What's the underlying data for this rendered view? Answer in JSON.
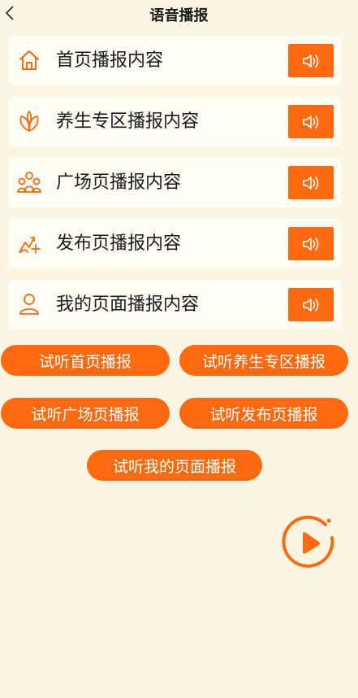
{
  "header": {
    "title": "语音播报",
    "back_icon": "chevron-left-icon"
  },
  "items": [
    {
      "label": "首页播报内容",
      "icon": "home-icon"
    },
    {
      "label": "养生专区播报内容",
      "icon": "leaf-icon"
    },
    {
      "label": "广场页播报内容",
      "icon": "group-icon"
    },
    {
      "label": "发布页播报内容",
      "icon": "publish-icon"
    },
    {
      "label": "我的页面播报内容",
      "icon": "user-icon"
    }
  ],
  "preview_buttons": [
    {
      "label": "试听首页播报"
    },
    {
      "label": "试听养生专区播报"
    },
    {
      "label": "试听广场页播报"
    },
    {
      "label": "试听发布页播报"
    },
    {
      "label": "试听我的页面播报"
    }
  ],
  "colors": {
    "accent": "#FF6A0F",
    "background": "#FBF6E3",
    "card": "#FFFDF4"
  }
}
